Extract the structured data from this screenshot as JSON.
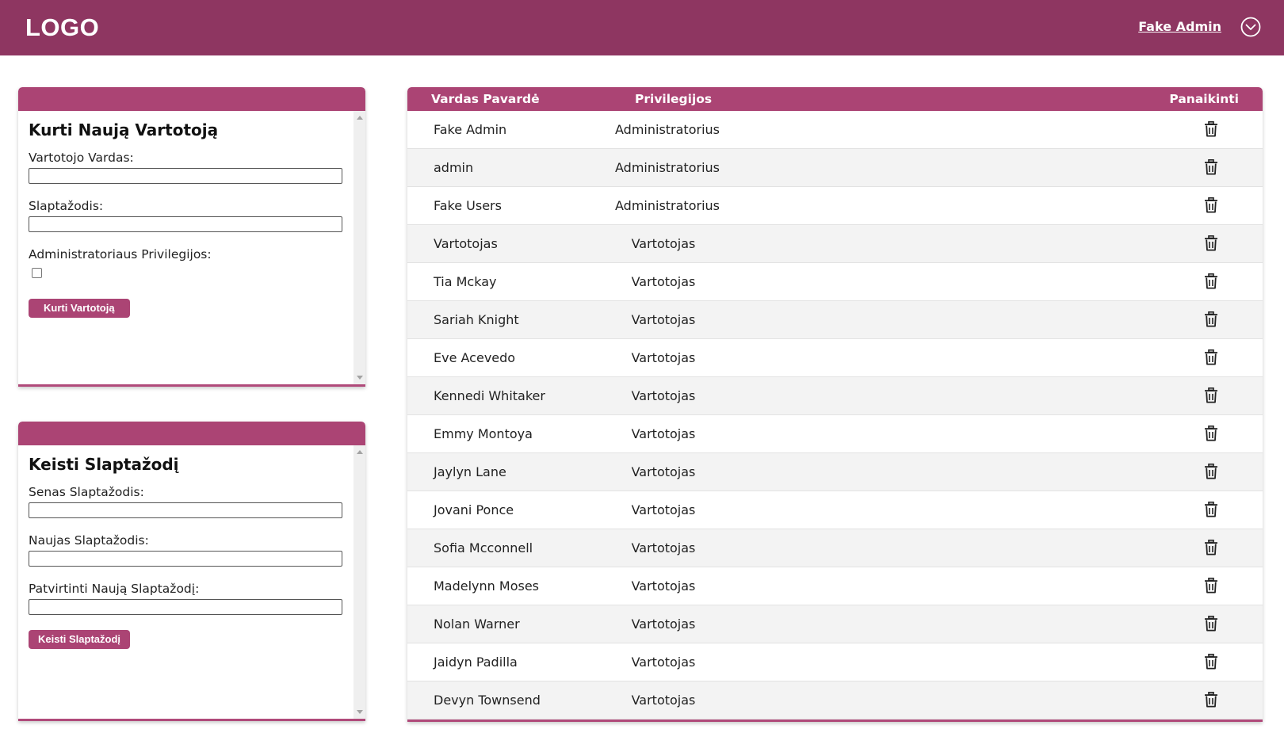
{
  "header": {
    "logo": "LOGO",
    "user_name": "Fake Admin",
    "user_menu_icon": "chevron-down-circle-icon"
  },
  "colors": {
    "header_bg": "#8e3661",
    "accent": "#ab4474"
  },
  "create_user": {
    "title": "Kurti Naują Vartotoją",
    "username_label": "Vartotojo Vardas:",
    "username_value": "",
    "password_label": "Slaptažodis:",
    "password_value": "",
    "admin_label": "Administratoriaus Privilegijos:",
    "admin_checked": false,
    "submit_label": "Kurti Vartotoją"
  },
  "change_password": {
    "title": "Keisti Slaptažodį",
    "old_label": "Senas Slaptažodis:",
    "new_label": "Naujas Slaptažodis:",
    "confirm_label": "Patvirtinti Naują Slaptažodį:",
    "submit_label": "Keisti Slaptažodį"
  },
  "users_table": {
    "columns": [
      "Vardas Pavardė",
      "Privilegijos",
      "Panaikinti"
    ],
    "delete_icon": "trash-icon",
    "rows": [
      {
        "name": "Fake Admin",
        "privilege": "Administratorius"
      },
      {
        "name": "admin",
        "privilege": "Administratorius"
      },
      {
        "name": "Fake Users",
        "privilege": "Administratorius"
      },
      {
        "name": "Vartotojas",
        "privilege": "Vartotojas"
      },
      {
        "name": "Tia Mckay",
        "privilege": "Vartotojas"
      },
      {
        "name": "Sariah Knight",
        "privilege": "Vartotojas"
      },
      {
        "name": "Eve Acevedo",
        "privilege": "Vartotojas"
      },
      {
        "name": "Kennedi Whitaker",
        "privilege": "Vartotojas"
      },
      {
        "name": "Emmy Montoya",
        "privilege": "Vartotojas"
      },
      {
        "name": "Jaylyn Lane",
        "privilege": "Vartotojas"
      },
      {
        "name": "Jovani Ponce",
        "privilege": "Vartotojas"
      },
      {
        "name": "Sofia Mcconnell",
        "privilege": "Vartotojas"
      },
      {
        "name": "Madelynn Moses",
        "privilege": "Vartotojas"
      },
      {
        "name": "Nolan Warner",
        "privilege": "Vartotojas"
      },
      {
        "name": "Jaidyn Padilla",
        "privilege": "Vartotojas"
      },
      {
        "name": "Devyn Townsend",
        "privilege": "Vartotojas"
      }
    ]
  }
}
